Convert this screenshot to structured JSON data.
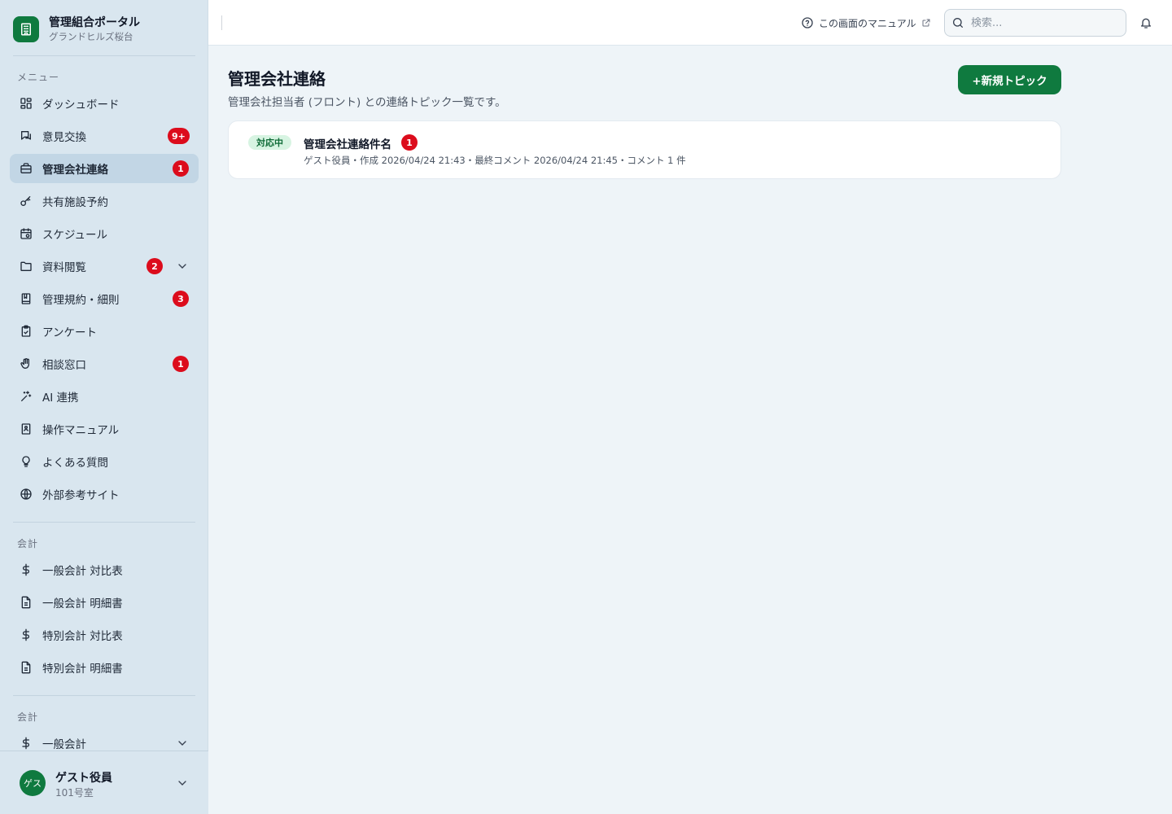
{
  "brand": {
    "title": "管理組合ポータル",
    "subtitle": "グランドヒルズ桜台"
  },
  "sidebar": {
    "menu_label": "メニュー",
    "items": [
      {
        "label": "ダッシュボード",
        "icon": "dashboard-icon"
      },
      {
        "label": "意見交換",
        "icon": "chat-icon",
        "badge": "9+"
      },
      {
        "label": "管理会社連絡",
        "icon": "briefcase-icon",
        "badge": "1",
        "active": true
      },
      {
        "label": "共有施設予約",
        "icon": "key-icon"
      },
      {
        "label": "スケジュール",
        "icon": "calendar-icon"
      },
      {
        "label": "資料閲覧",
        "icon": "folder-icon",
        "badge": "2",
        "expandable": true
      },
      {
        "label": "管理規約・細則",
        "icon": "book-icon",
        "badge": "3"
      },
      {
        "label": "アンケート",
        "icon": "clipboard-icon"
      },
      {
        "label": "相談窓口",
        "icon": "hand-icon",
        "badge": "1"
      },
      {
        "label": "AI 連携",
        "icon": "sparkle-icon"
      },
      {
        "label": "操作マニュアル",
        "icon": "manual-icon"
      },
      {
        "label": "よくある質問",
        "icon": "lightbulb-icon"
      },
      {
        "label": "外部参考サイト",
        "icon": "globe-icon"
      }
    ],
    "accounting_label": "会計",
    "accounting_items": [
      {
        "label": "一般会計 対比表",
        "icon": "dollar-icon"
      },
      {
        "label": "一般会計 明細書",
        "icon": "document-icon"
      },
      {
        "label": "特別会計 対比表",
        "icon": "dollar-icon"
      },
      {
        "label": "特別会計 明細書",
        "icon": "document-icon"
      }
    ],
    "accounting2_label": "会計",
    "accounting2_items": [
      {
        "label": "一般会計",
        "icon": "dollar-icon",
        "expandable": true
      }
    ]
  },
  "user": {
    "avatar": "ゲス",
    "name": "ゲスト役員",
    "room": "101号室"
  },
  "header": {
    "manual_link": "この画面のマニュアル",
    "search_placeholder": "検索..."
  },
  "main": {
    "title": "管理会社連絡",
    "description": "管理会社担当者 (フロント) との連絡トピック一覧です。",
    "new_button": "+新規トピック",
    "topics": [
      {
        "status": "対応中",
        "title": "管理会社連絡件名",
        "badge": "1",
        "meta": "ゲスト役員・作成 2026/04/24 21:43・最終コメント 2026/04/24 21:45・コメント 1 件"
      }
    ]
  },
  "colors": {
    "brand": "#0f7a3f",
    "badge": "#dc0c1c",
    "sidebar": "#d9e6ef",
    "active": "#c2d6e5"
  }
}
